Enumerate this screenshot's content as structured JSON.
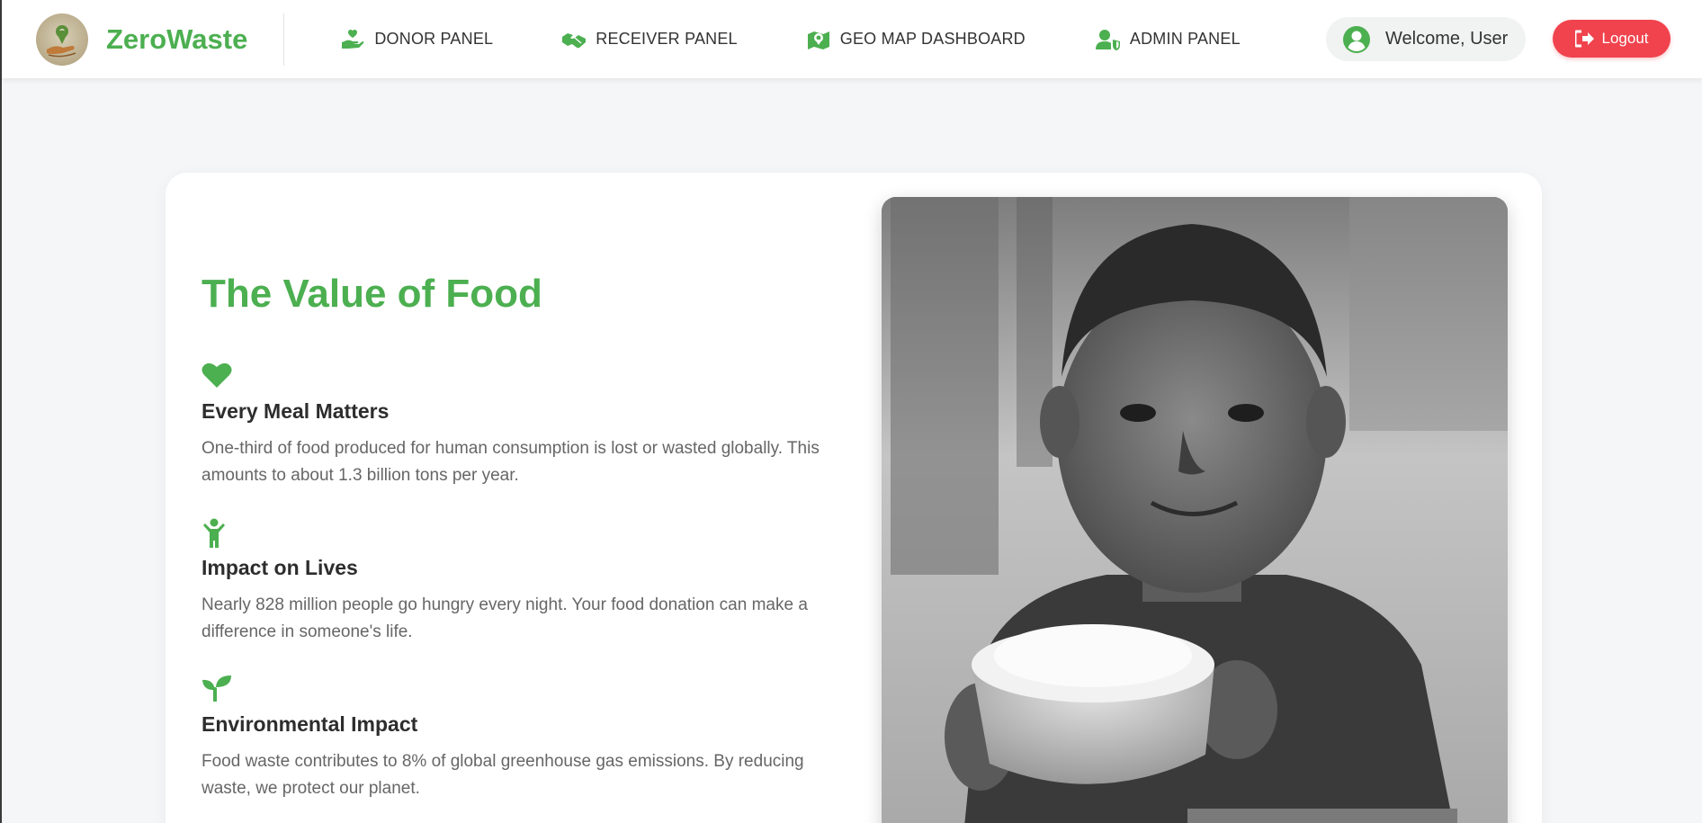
{
  "brand": {
    "name": "ZeroWaste",
    "logo_icon": "location-pin-hand-icon"
  },
  "nav": {
    "items": [
      {
        "label": "DONOR PANEL",
        "icon": "hand-heart-icon"
      },
      {
        "label": "RECEIVER PANEL",
        "icon": "handshake-icon"
      },
      {
        "label": "GEO MAP DASHBOARD",
        "icon": "map-location-icon"
      },
      {
        "label": "ADMIN PANEL",
        "icon": "user-shield-icon"
      }
    ]
  },
  "user": {
    "welcome": "Welcome, User",
    "icon": "user-circle-icon"
  },
  "logout": {
    "label": "Logout",
    "icon": "sign-out-icon"
  },
  "colors": {
    "accent": "#4caf50",
    "logout": "#f0434d",
    "text": "#2d2d2d",
    "muted": "#666666"
  },
  "main": {
    "title": "The Value of Food",
    "features": [
      {
        "icon": "heart-icon",
        "title": "Every Meal Matters",
        "text": "One-third of food produced for human consumption is lost or wasted globally. This amounts to about 1.3 billion tons per year."
      },
      {
        "icon": "child-icon",
        "title": "Impact on Lives",
        "text": "Nearly 828 million people go hungry every night. Your food donation can make a difference in someone's life."
      },
      {
        "icon": "seedling-icon",
        "title": "Environmental Impact",
        "text": "Food waste contributes to 8% of global greenhouse gas emissions. By reducing waste, we protect our planet."
      }
    ]
  }
}
